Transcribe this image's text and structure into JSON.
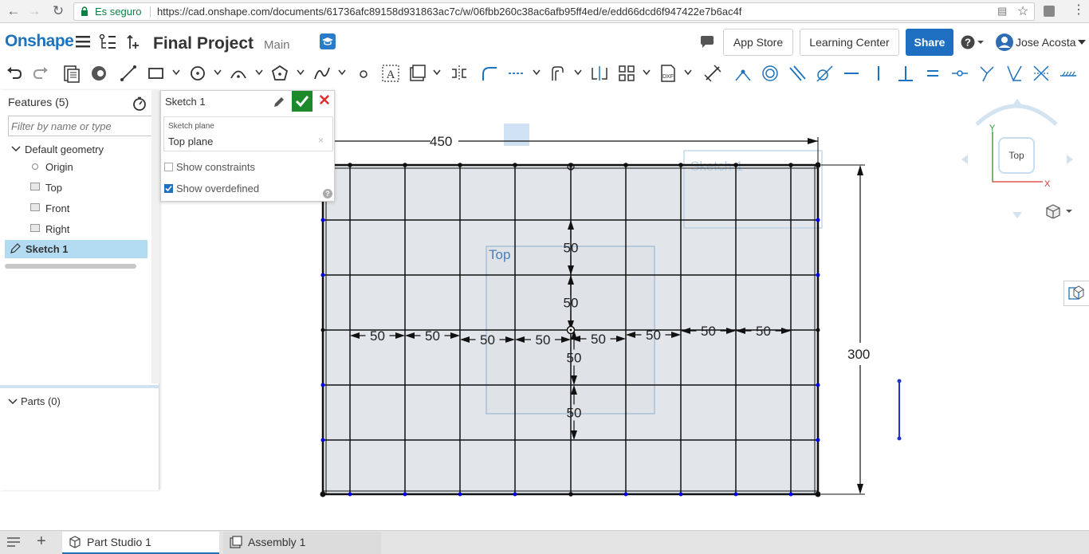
{
  "browser": {
    "secure_label": "Es seguro",
    "url": "https://cad.onshape.com/documents/61736afc89158d931863ac7c/w/06fbb260c38ac6afb95ff4ed/e/edd66dcd6f947422e7b6ac4f"
  },
  "header": {
    "logo": "Onshape",
    "document_title": "Final Project",
    "branch": "Main",
    "app_store_label": "App Store",
    "learning_center_label": "Learning Center",
    "share_label": "Share",
    "user_name": "Jose Acosta"
  },
  "features": {
    "heading": "Features (5)",
    "filter_placeholder": "Filter by name or type",
    "default_geometry_label": "Default geometry",
    "items": [
      {
        "label": "Origin",
        "icon": "origin-icon"
      },
      {
        "label": "Top",
        "icon": "plane-icon"
      },
      {
        "label": "Front",
        "icon": "plane-icon"
      },
      {
        "label": "Right",
        "icon": "plane-icon"
      }
    ],
    "selected_item": "Sketch 1",
    "parts_label": "Parts (0)"
  },
  "sketch_dialog": {
    "title": "Sketch 1",
    "plane_label": "Sketch plane",
    "plane_value": "Top plane",
    "plane_clear": "×",
    "show_constraints_label": "Show constraints",
    "show_constraints_checked": false,
    "show_overdefined_label": "Show overdefined",
    "show_overdefined_checked": true,
    "help": "?"
  },
  "viewport": {
    "plane_label_top": "Top",
    "plane_label_sketch": "Sketch 1",
    "dimension_width": "450",
    "dimension_height": "300",
    "dimension_50": "50",
    "view_cube_label": "Top",
    "axis_y": "Y",
    "axis_x": "X",
    "accent_color": "#1e73be",
    "constraint_point_color": "#0000ee"
  },
  "tabs": [
    {
      "label": "Part Studio 1",
      "active": true
    },
    {
      "label": "Assembly 1",
      "active": false
    }
  ]
}
